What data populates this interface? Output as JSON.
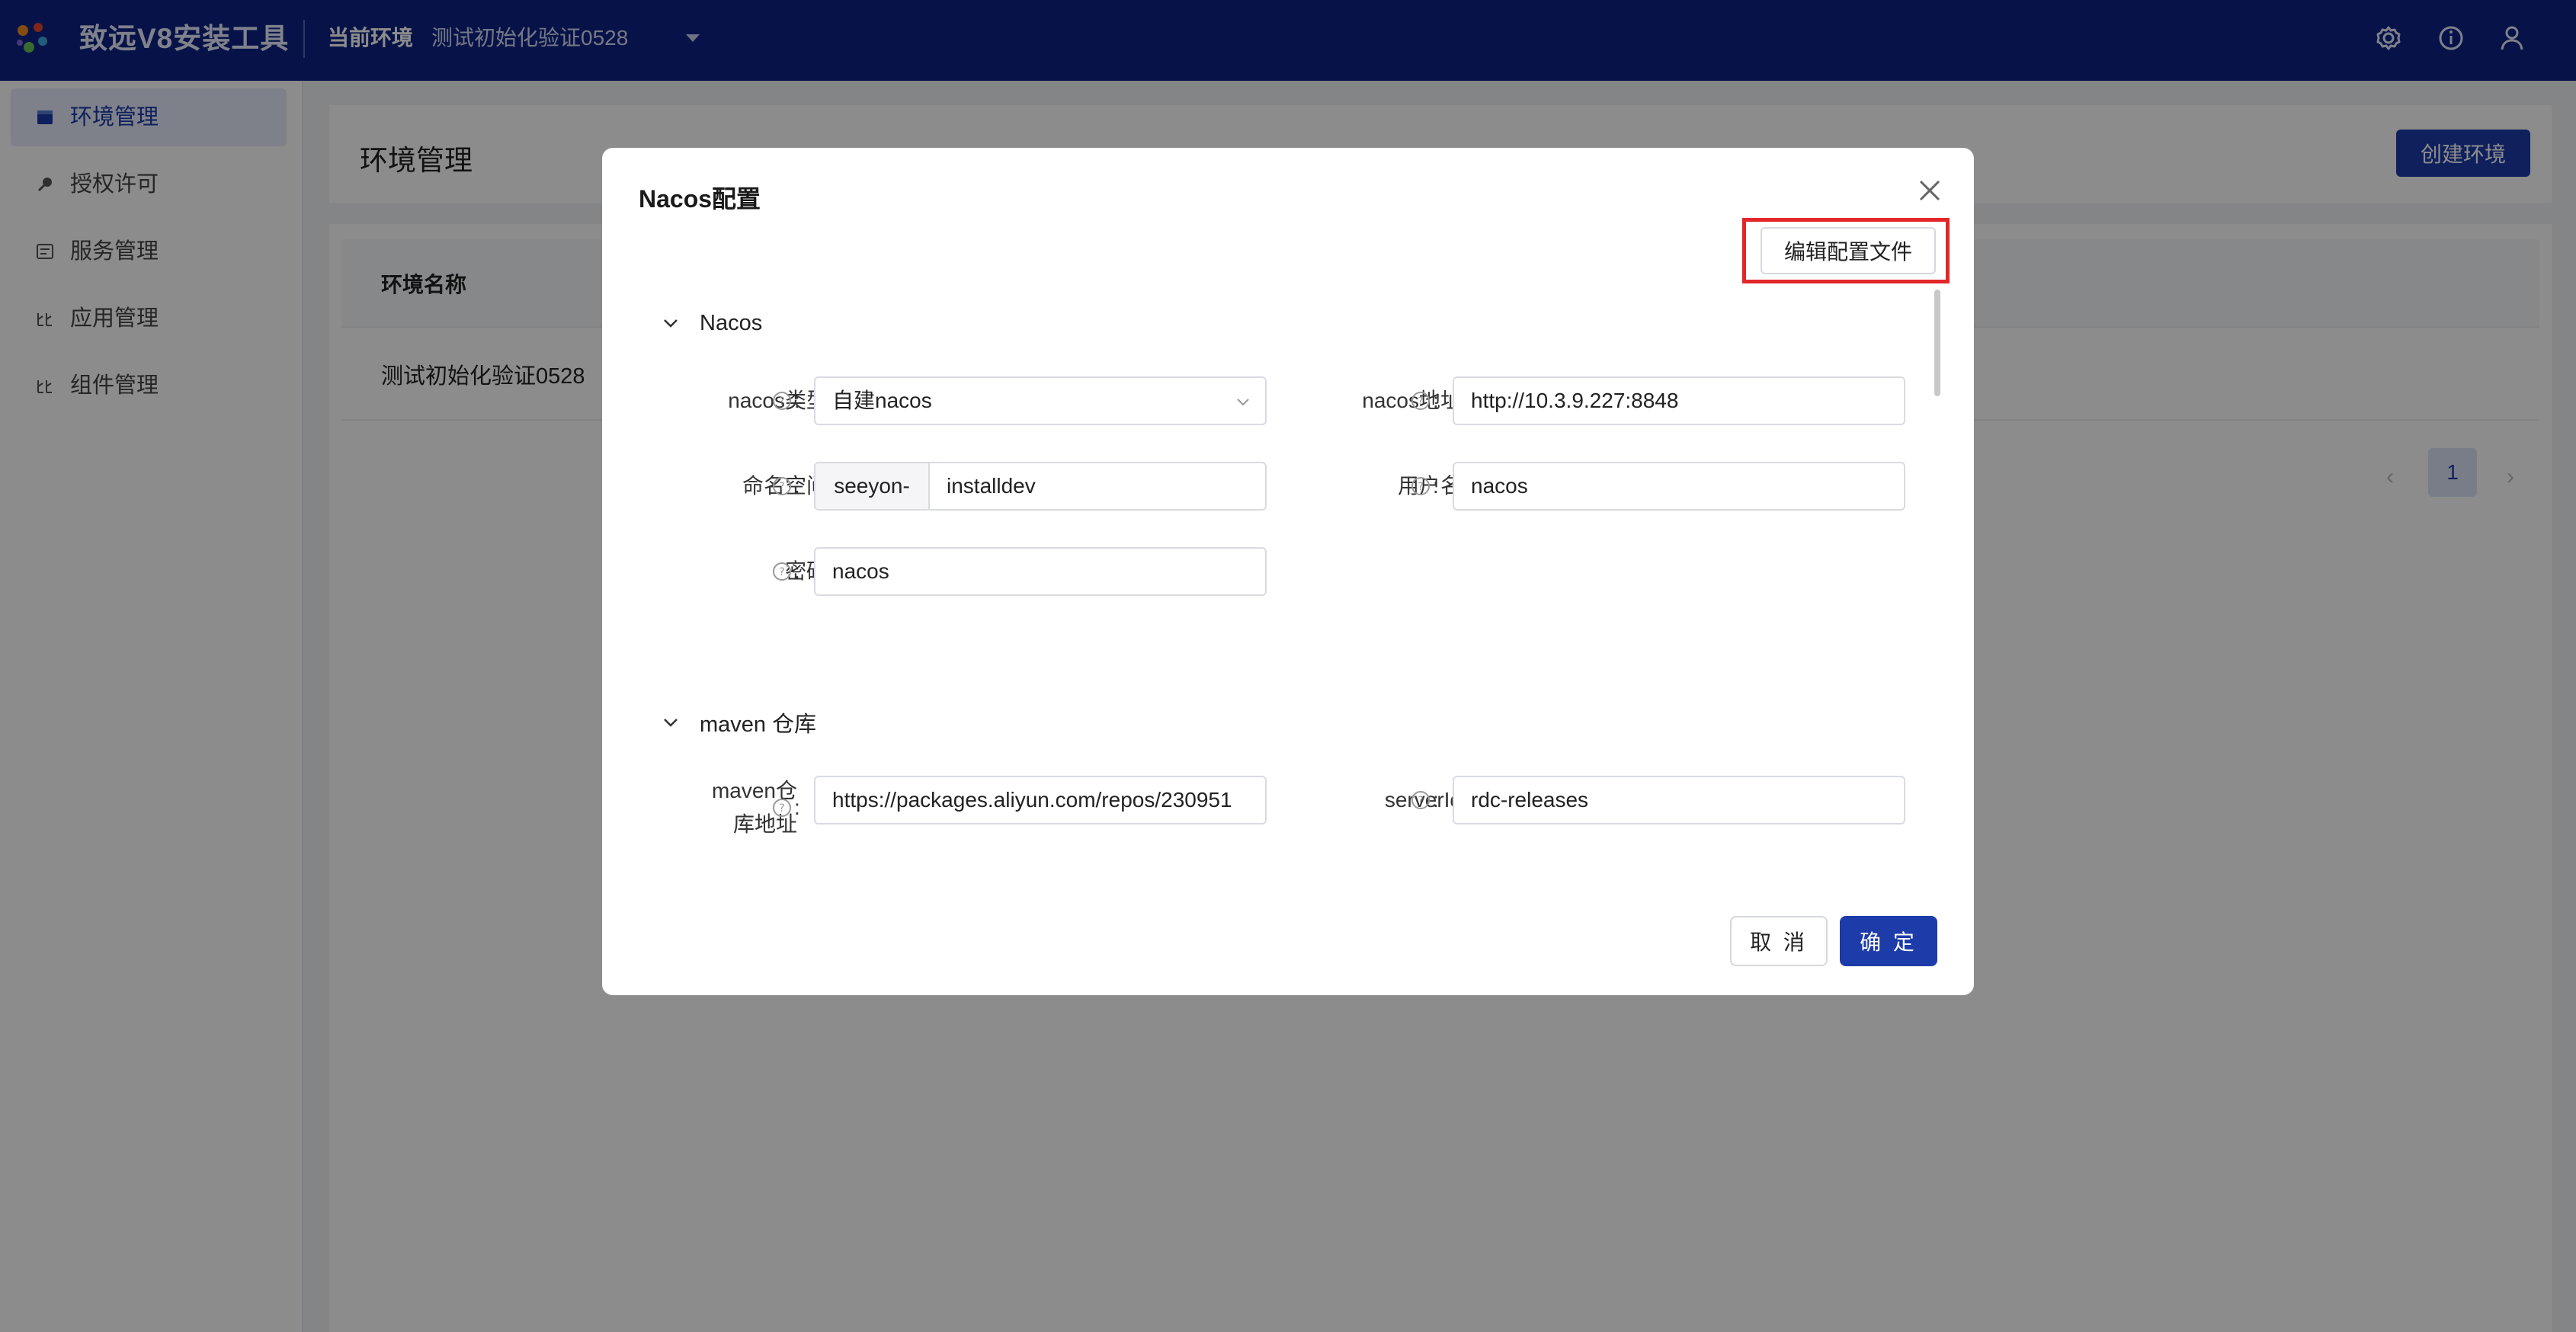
{
  "header": {
    "app_title": "致远V8安装工具",
    "env_label": "当前环境",
    "env_value": "测试初始化验证0528"
  },
  "sidebar": {
    "items": [
      {
        "label": "环境管理",
        "icon": "window-icon",
        "active": true
      },
      {
        "label": "授权许可",
        "icon": "key-icon",
        "active": false
      },
      {
        "label": "服务管理",
        "icon": "service-icon",
        "active": false
      },
      {
        "label": "应用管理",
        "icon": "app-icon",
        "active": false
      },
      {
        "label": "组件管理",
        "icon": "component-icon",
        "active": false
      }
    ]
  },
  "main": {
    "title": "环境管理",
    "create_button": "创建环境",
    "table": {
      "columns": [
        "环境名称"
      ],
      "rows": [
        [
          "测试初始化验证0528"
        ]
      ]
    },
    "pagination": {
      "current_page": "1"
    }
  },
  "modal": {
    "title": "Nacos配置",
    "edit_button": "编辑配置文件",
    "sections": [
      {
        "label": "Nacos",
        "fields": [
          {
            "label": "nacos类型",
            "value": "自建nacos",
            "type": "select"
          },
          {
            "label": "nacos地址",
            "value": "http://10.3.9.227:8848"
          },
          {
            "label": "命名空间",
            "prefix": "seeyon-",
            "value": "installdev"
          },
          {
            "label": "用户名",
            "value": "nacos"
          },
          {
            "label": "密码",
            "value": "nacos"
          }
        ]
      },
      {
        "label": "maven 仓库",
        "fields": [
          {
            "label": "maven仓库地址",
            "label_line1": "maven仓",
            "label_line2": "库地址",
            "value": "https://packages.aliyun.com/repos/230951"
          },
          {
            "label": "serverId",
            "value": "rdc-releases"
          }
        ]
      }
    ],
    "cancel_button": "取 消",
    "ok_button": "确 定"
  },
  "colors": {
    "header_bg": "#0d2483",
    "primary": "#1d3ba9",
    "highlight_border": "#e3262a"
  }
}
